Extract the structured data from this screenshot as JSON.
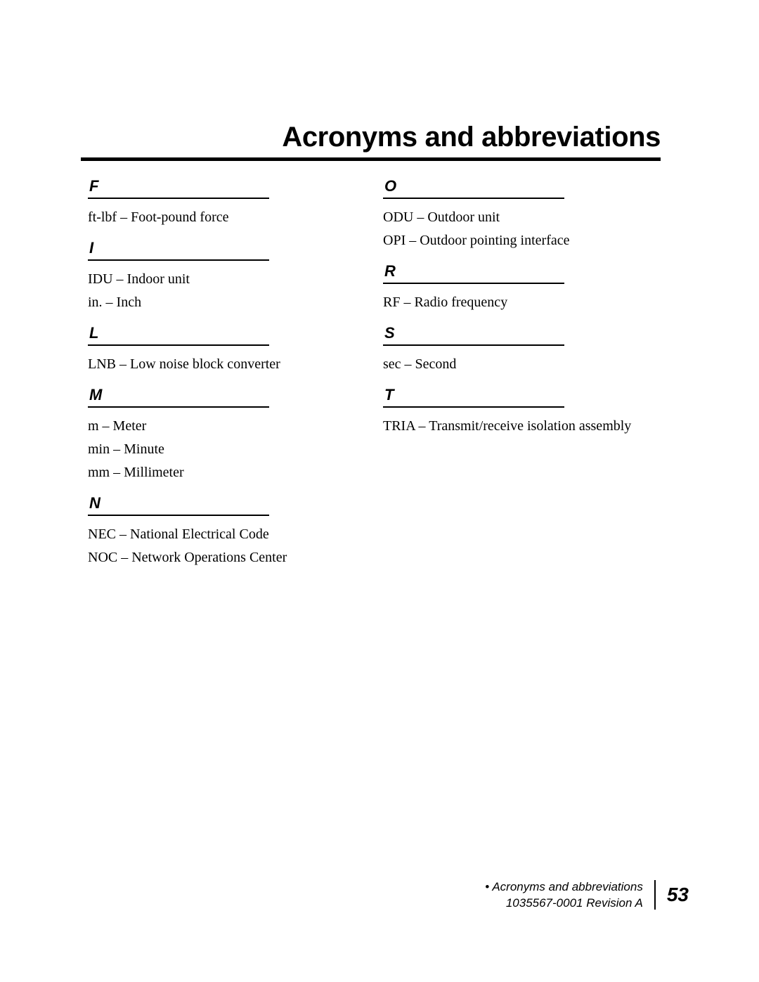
{
  "document": {
    "title": "Acronyms and abbreviations"
  },
  "columns": {
    "left": [
      {
        "letter": "F",
        "entries": [
          "ft-lbf – Foot-pound force"
        ]
      },
      {
        "letter": "I",
        "entries": [
          "IDU – Indoor unit",
          "in. – Inch"
        ]
      },
      {
        "letter": "L",
        "entries": [
          "LNB – Low noise block converter"
        ]
      },
      {
        "letter": "M",
        "entries": [
          "m – Meter",
          "min – Minute",
          "mm – Millimeter"
        ]
      },
      {
        "letter": "N",
        "entries": [
          "NEC – National Electrical Code",
          "NOC – Network Operations Center"
        ]
      }
    ],
    "right": [
      {
        "letter": "O",
        "entries": [
          "ODU – Outdoor unit",
          "OPI – Outdoor pointing interface"
        ]
      },
      {
        "letter": "R",
        "entries": [
          "RF – Radio frequency"
        ]
      },
      {
        "letter": "S",
        "entries": [
          "sec – Second"
        ]
      },
      {
        "letter": "T",
        "entries": [
          "TRIA – Transmit/receive isolation assembly"
        ]
      }
    ]
  },
  "footer": {
    "chapter_line": "• Acronyms and abbreviations",
    "document_line": "1035567-0001  Revision A",
    "page_number": "53"
  }
}
